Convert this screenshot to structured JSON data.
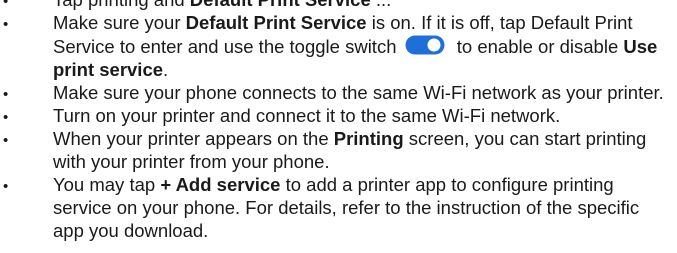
{
  "items": [
    {
      "id": "clipped",
      "segments": [
        "Tap printing and ",
        "Default Print Service",
        " ..."
      ]
    },
    {
      "id": "default-print-service",
      "segments": [
        "Make sure your ",
        "Default Print Service",
        " is on. If it is off, tap Default Print Service to enter and use the toggle switch ",
        " to enable or disable ",
        "Use print service",
        "."
      ],
      "toggle": {
        "icon": "toggle-switch-icon",
        "state": "on",
        "track_color": "#1e6fd9",
        "knob_color": "#ffffff"
      }
    },
    {
      "id": "same-network",
      "text": "Make sure your phone connects to the same Wi-Fi network as your printer."
    },
    {
      "id": "turn-on-printer",
      "text": "Turn on your printer and connect it to the same Wi-Fi network."
    },
    {
      "id": "printer-appears",
      "segments": [
        "When your printer appears on the ",
        "Printing",
        " screen, you can start printing with your printer from your phone."
      ]
    },
    {
      "id": "add-service",
      "segments": [
        "You may tap ",
        "+ Add service",
        " to add a printer app to configure printing service on your phone. For details, refer to the instruction of the specific app you download."
      ]
    }
  ]
}
